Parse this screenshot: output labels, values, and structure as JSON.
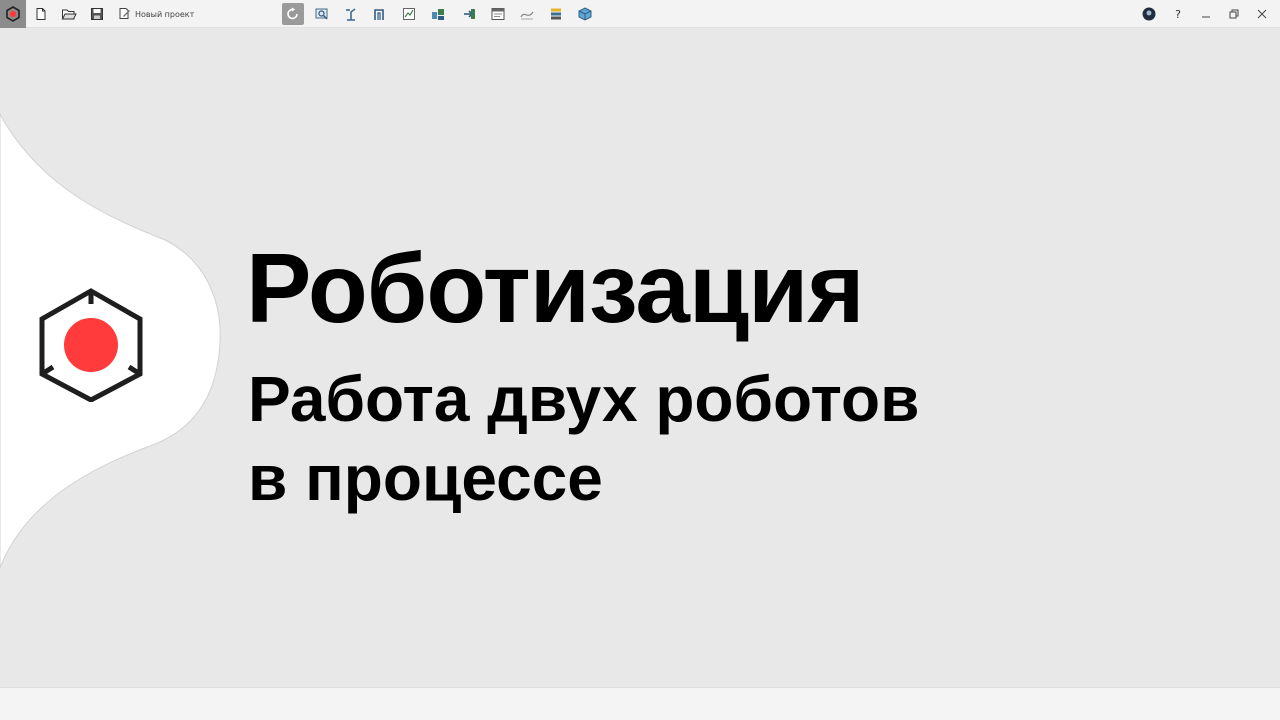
{
  "toolbar": {
    "project_name": "Новый проект",
    "help_label": "?",
    "buttons": [
      {
        "name": "app-logo-icon"
      },
      {
        "name": "new-file-icon"
      },
      {
        "name": "open-folder-icon"
      },
      {
        "name": "save-icon"
      },
      {
        "name": "rotate-view-icon"
      },
      {
        "name": "zoom-view-icon"
      },
      {
        "name": "robot-tool-icon"
      },
      {
        "name": "frame-tool-icon"
      },
      {
        "name": "chart-tool-icon"
      },
      {
        "name": "assembly-tool-icon"
      },
      {
        "name": "import-tool-icon"
      },
      {
        "name": "layout-tool-icon"
      },
      {
        "name": "path-tool-icon"
      },
      {
        "name": "stack-tool-icon"
      },
      {
        "name": "cube-tool-icon"
      }
    ]
  },
  "slide": {
    "title": "Роботизация",
    "subtitle_line1": "Работа двух роботов",
    "subtitle_line2": "в процессе"
  },
  "colors": {
    "accent_red": "#ff3b3b",
    "background": "#e8e8e8",
    "toolbar": "#f3f3f3",
    "text": "#000000"
  }
}
